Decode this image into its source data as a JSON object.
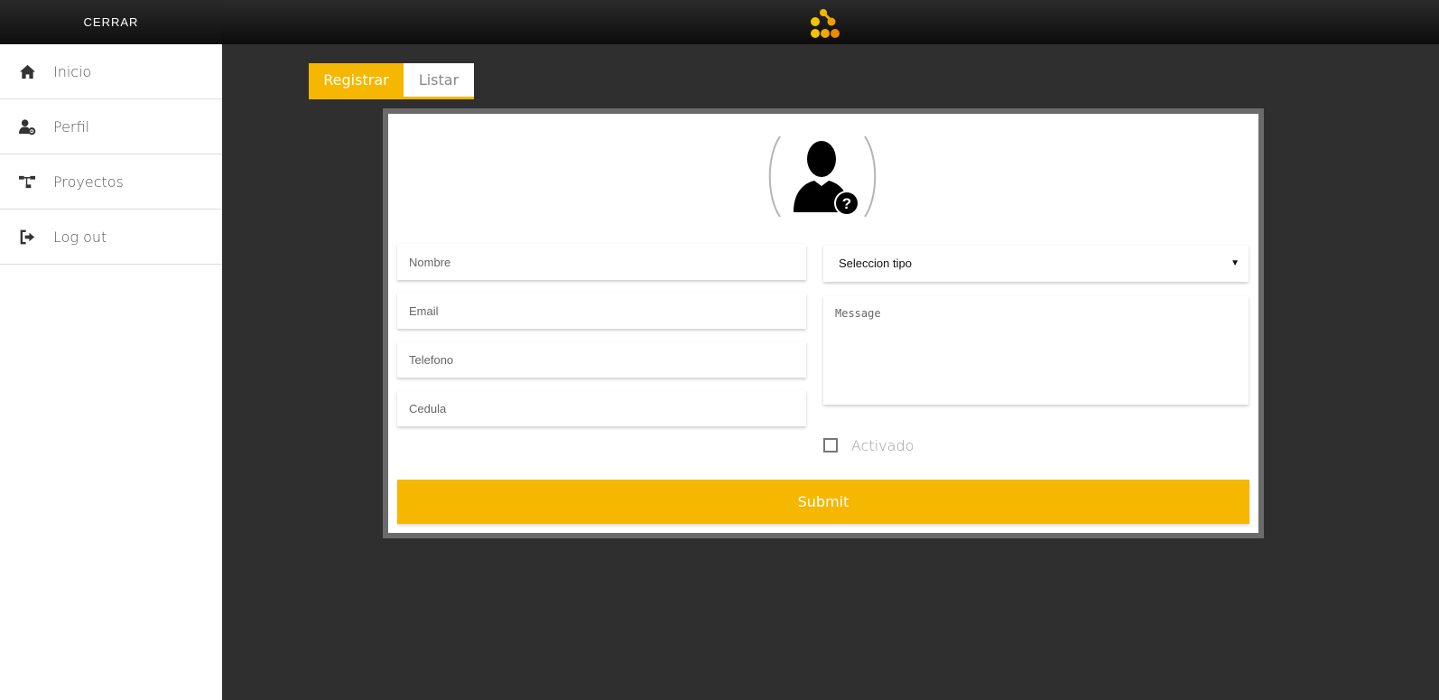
{
  "sidebar": {
    "close_label": "CERRAR",
    "items": [
      {
        "label": "Inicio",
        "icon": "home-icon"
      },
      {
        "label": "Perfil",
        "icon": "user-settings-icon"
      },
      {
        "label": "Proyectos",
        "icon": "project-tree-icon"
      },
      {
        "label": "Log out",
        "icon": "logout-icon"
      }
    ]
  },
  "tabs": {
    "register": "Registrar",
    "list": "Listar"
  },
  "form": {
    "nombre_placeholder": "Nombre",
    "email_placeholder": "Email",
    "telefono_placeholder": "Telefono",
    "cedula_placeholder": "Cedula",
    "tipo_selected": "Seleccion tipo",
    "message_placeholder": "Message",
    "activado_label": "Activado",
    "submit_label": "Submit"
  },
  "colors": {
    "accent": "#f5b700",
    "background": "#2f2f2f",
    "sidebar": "#ffffff"
  }
}
